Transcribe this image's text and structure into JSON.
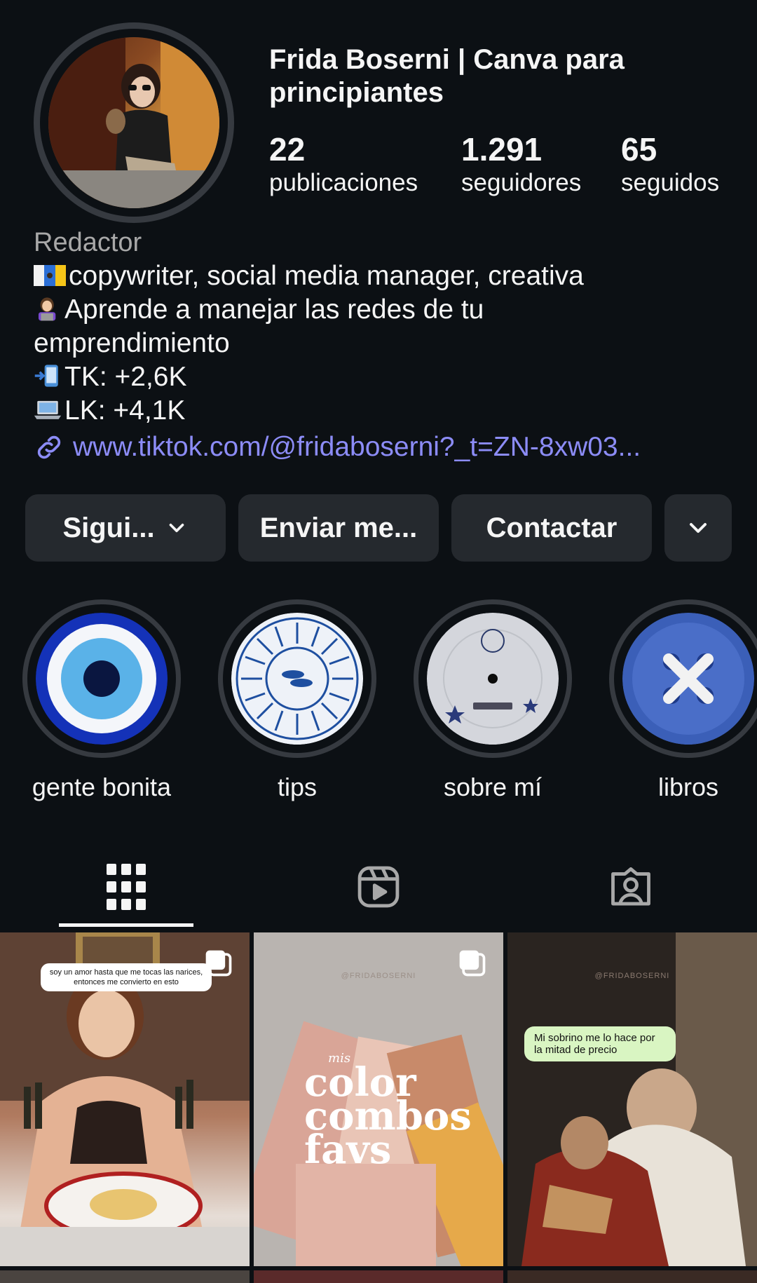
{
  "profile": {
    "name": "Frida Boserni | Canva para principiantes",
    "category": "Redactor",
    "bio_lines": [
      "copywriter, social media manager, creativa",
      "Aprende a manejar las redes de tu",
      "emprendimiento",
      "TK: +2,6K",
      "LK: +4,1K"
    ],
    "link": "www.tiktok.com/@fridaboserni?_t=ZN-8xw03..."
  },
  "stats": {
    "posts": {
      "value": "22",
      "label": "publicaciones"
    },
    "followers": {
      "value": "1.291",
      "label": "seguidores"
    },
    "following": {
      "value": "65",
      "label": "seguidos"
    }
  },
  "actions": {
    "follow_label": "Sigui...",
    "message_label": "Enviar me...",
    "contact_label": "Contactar",
    "more_icon": "chevron-down-icon"
  },
  "highlights": [
    {
      "label": "gente bonita"
    },
    {
      "label": "tips"
    },
    {
      "label": "sobre mí"
    },
    {
      "label": "libros"
    }
  ],
  "tabs": [
    {
      "icon": "grid-icon",
      "active": true
    },
    {
      "icon": "reels-icon",
      "active": false
    },
    {
      "icon": "tagged-icon",
      "active": false
    }
  ],
  "posts": [
    {
      "caption": "soy un amor hasta que me tocas las narices, entonces me convierto en esto",
      "multi": true
    },
    {
      "watermark": "@FRIDABOSERNI",
      "title_small": "mis",
      "title_lines": [
        "color",
        "combos",
        "favs"
      ],
      "multi": true
    },
    {
      "watermark": "@FRIDABOSERNI",
      "caption": "Mi sobrino me lo hace por la mitad de precio",
      "multi": false
    }
  ],
  "colors": {
    "background": "#0c1014",
    "button": "#25292e",
    "link": "#8c8cf7",
    "muted": "#a8a8a8"
  }
}
